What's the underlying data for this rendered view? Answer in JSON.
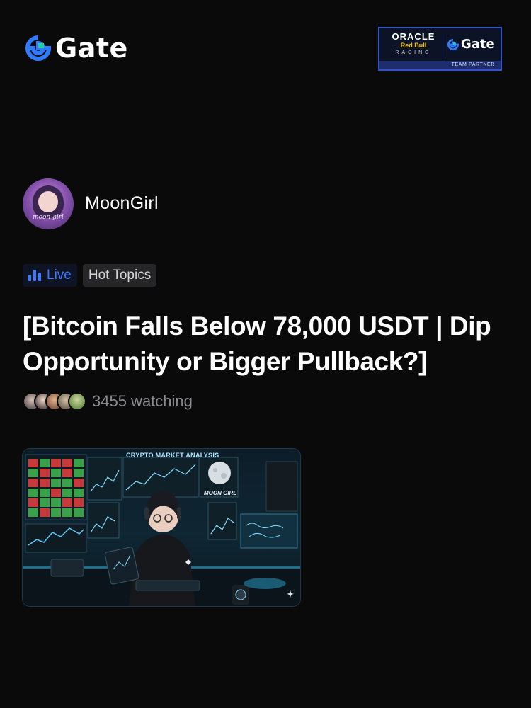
{
  "header": {
    "brand_name": "Gate",
    "brand_color": "#2f7cff",
    "partner_badge": {
      "oracle": "ORACLE",
      "redbull": "Red Bull",
      "racing": "RACING",
      "brand": "Gate",
      "strip": "TEAM PARTNER"
    }
  },
  "author": {
    "name": "MoonGirl",
    "avatar_signature": "moon girl"
  },
  "tags": {
    "live": "Live",
    "topic": "Hot Topics"
  },
  "post": {
    "title": "[Bitcoin Falls Below 78,000 USDT | Dip Opportunity or Bigger Pullback?]",
    "watching": "3455 watching"
  },
  "thumbnail": {
    "headline": "CRYPTO MARKET ANALYSIS",
    "moon_label": "MOON GIRL",
    "sparkle_icon": "sparkle-icon"
  },
  "colors": {
    "background": "#0a0a0b",
    "accent_blue": "#3c7bff",
    "muted_text": "#8b8b8f"
  }
}
